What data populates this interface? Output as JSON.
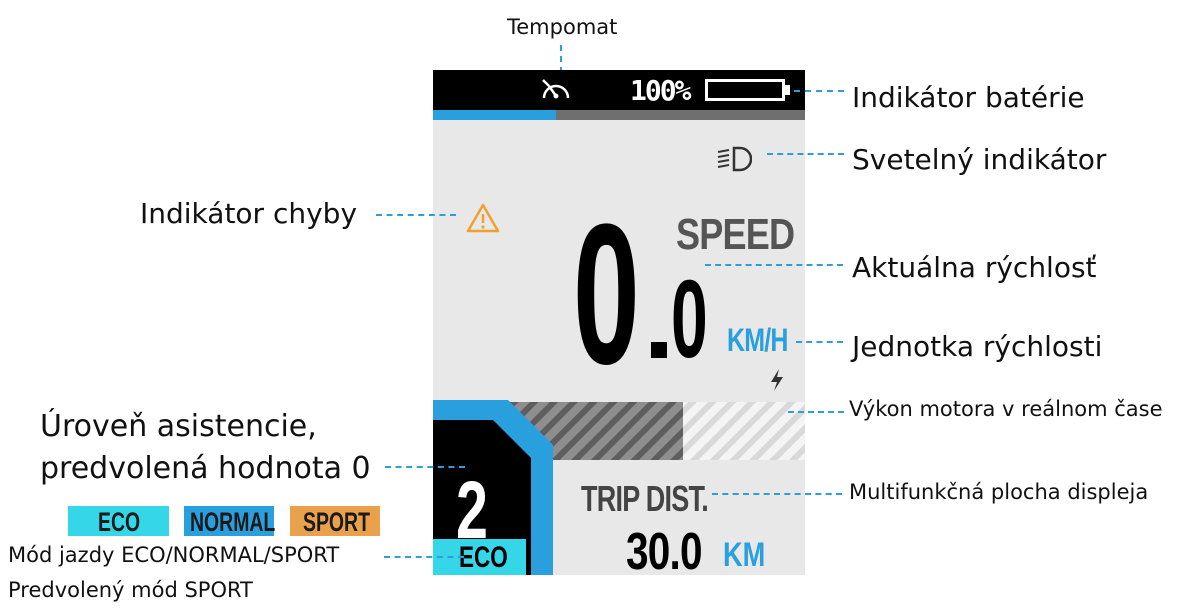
{
  "display": {
    "battery_percent": "100%",
    "battery_level": 1.0,
    "speed_label": "SPEED",
    "speed_integer": "0",
    "speed_decimal": "0",
    "speed_unit": "KM/H",
    "assist_level": "2",
    "drive_mode": "ECO",
    "trip_label": "TRIP DIST.",
    "trip_value": "30.0",
    "trip_unit": "KM",
    "progress_fraction": 0.33,
    "icons": [
      "cruise-control-icon",
      "headlight-icon",
      "warning-icon",
      "lightning-icon"
    ]
  },
  "callouts": {
    "cruise": "Tempomat",
    "battery": "Indikátor batérie",
    "light": "Svetelný indikátor",
    "error": "Indikátor chyby",
    "speed": "Aktuálna rýchlosť",
    "unit": "Jednotka rýchlosti",
    "power": "Výkon motora v reálnom čase",
    "assist_line1": "Úroveň asistencie,",
    "assist_line2": "predvolená hodnota 0",
    "multifunction": "Multifunkčná plocha displeja",
    "mode_line1": "Mód jazdy ECO/NORMAL/SPORT",
    "mode_line2": "Predvolený mód SPORT"
  },
  "mode_legend": [
    {
      "label": "ECO",
      "color": "#35d6e8"
    },
    {
      "label": "NORMAL",
      "color": "#2a9fde"
    },
    {
      "label": "SPORT",
      "color": "#e9a24b"
    }
  ],
  "colors": {
    "accent_blue": "#2a9fde",
    "eco_cyan": "#35d6e8",
    "warning_orange": "#f0a030",
    "panel_gray": "#e8e8e8"
  }
}
